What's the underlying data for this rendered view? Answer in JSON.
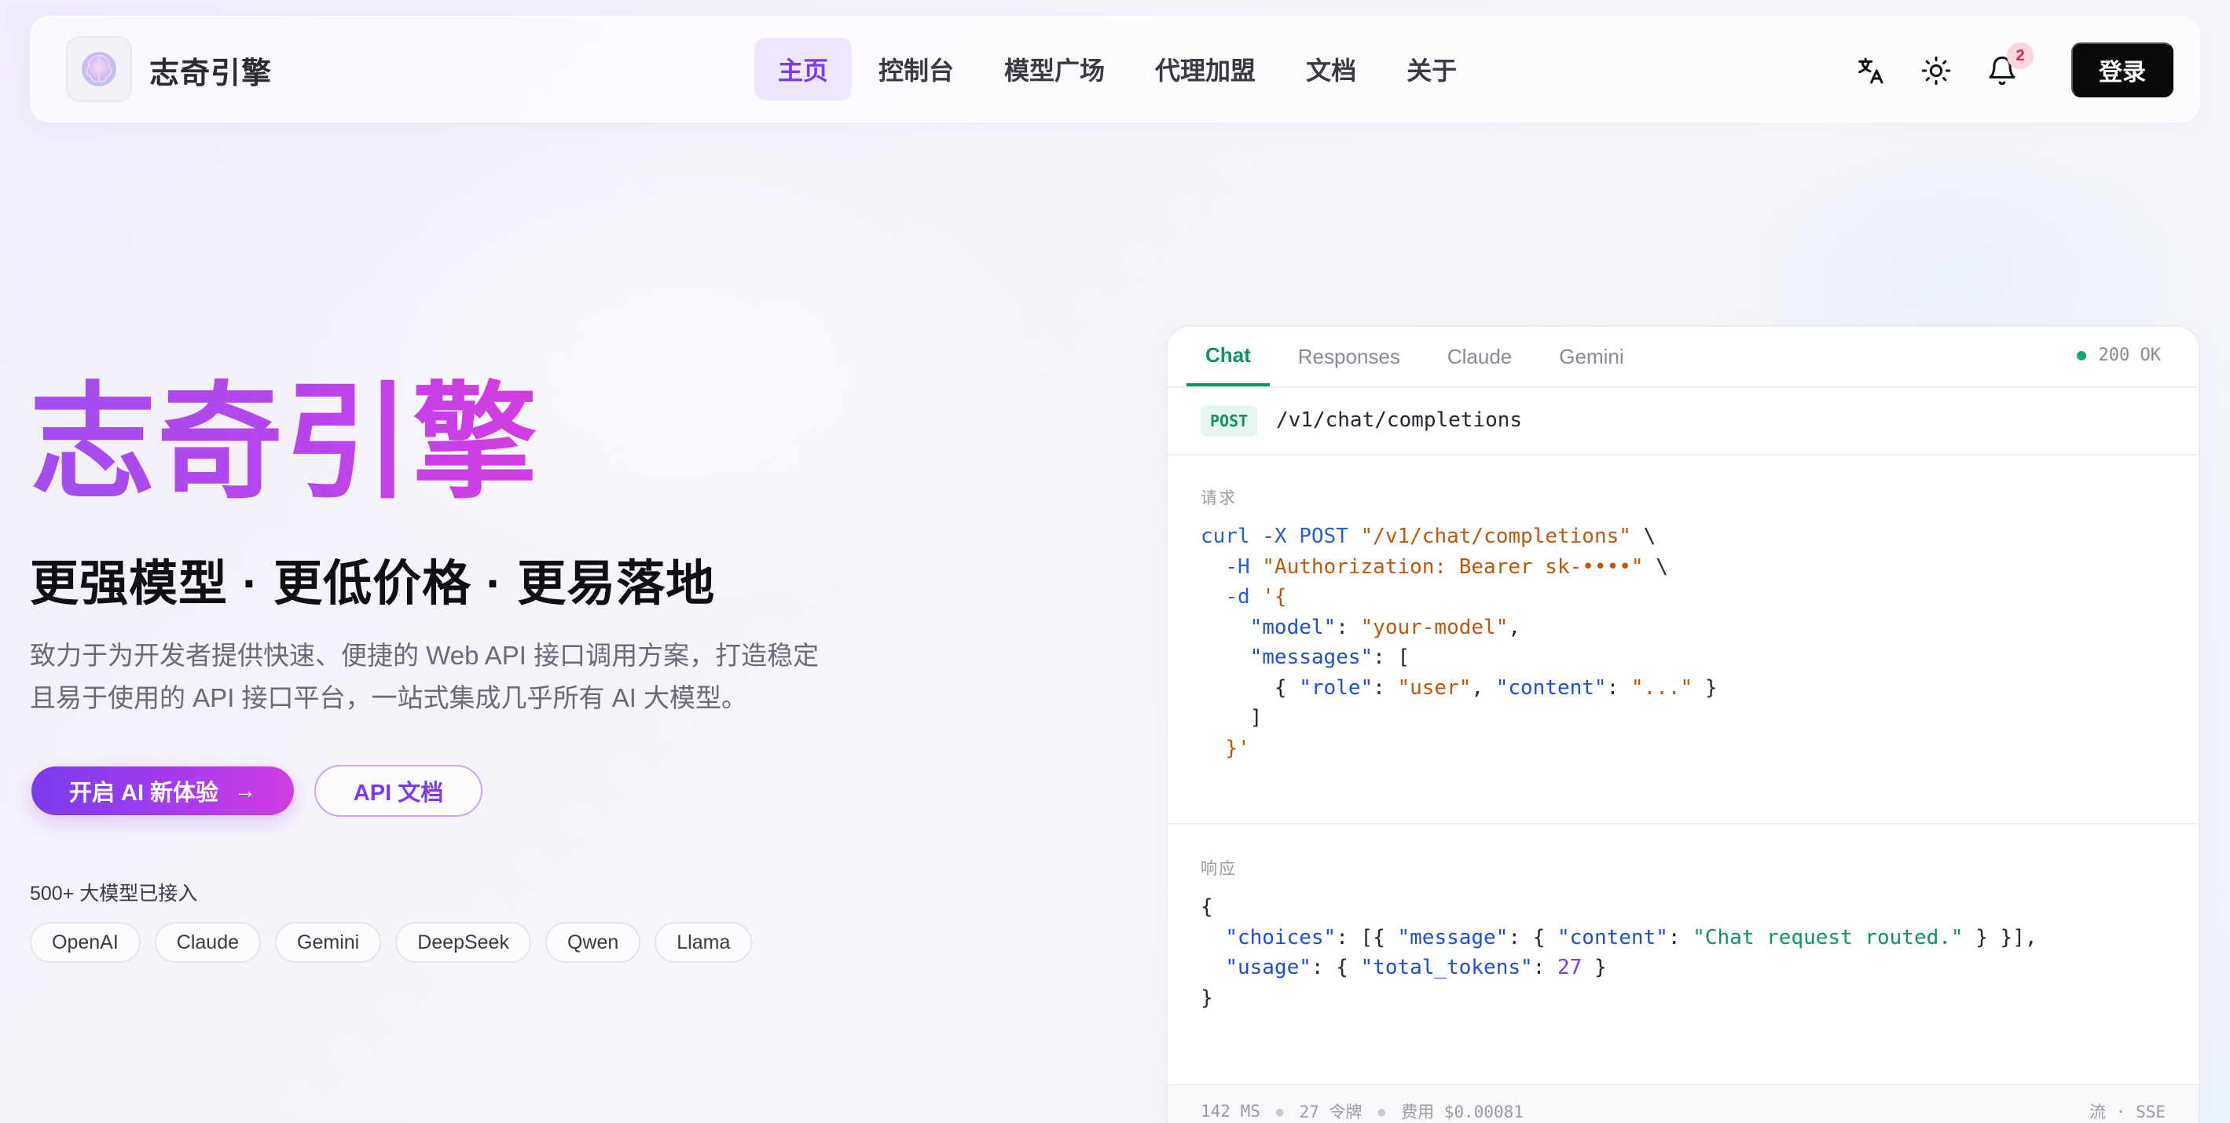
{
  "nav": {
    "brand": "志奇引擎",
    "links": [
      "主页",
      "控制台",
      "模型广场",
      "代理加盟",
      "文档",
      "关于"
    ],
    "active_index": 0,
    "icons": [
      "translate-icon",
      "sun-icon",
      "bell-icon"
    ],
    "notification_count": "2",
    "login_label": "登录"
  },
  "hero": {
    "title": "志奇引擎",
    "subtitle": "更强模型 · 更低价格 · 更易落地",
    "description_line1": "致力于为开发者提供快速、便捷的 Web API 接口调用方案，打造稳定",
    "description_line2": "且易于使用的 API 接口平台，一站式集成几乎所有 AI 大模型。",
    "cta_primary": "开启 AI 新体验",
    "cta_secondary": "API 文档",
    "models_count": "500+ 大模型已接入",
    "models": [
      "OpenAI",
      "Claude",
      "Gemini",
      "DeepSeek",
      "Qwen",
      "Llama"
    ]
  },
  "code_panel": {
    "tabs": [
      "Chat",
      "Responses",
      "Claude",
      "Gemini"
    ],
    "active_tab": 0,
    "status": "200 OK",
    "method": "POST",
    "endpoint": "/v1/chat/completions",
    "request_label": "请求",
    "response_label": "响应",
    "footer": {
      "latency": "142 MS",
      "tokens": "27 令牌",
      "cost": "费用 $0.00081",
      "stream": "流 · SSE"
    }
  },
  "colors": {
    "brand_gradient_start": "#a24ef0",
    "brand_gradient_end": "#d43ce0",
    "accent_purple": "#7c3aed",
    "status_green": "#11906b",
    "login_bg": "#0a0a0a"
  }
}
